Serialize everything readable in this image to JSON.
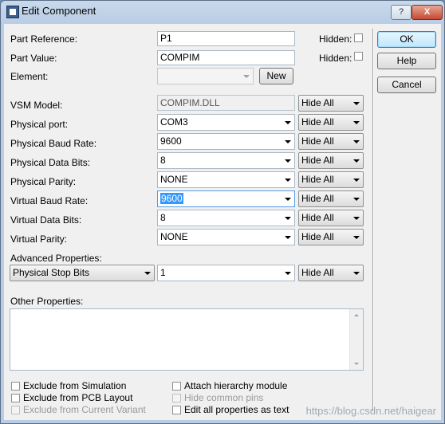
{
  "window": {
    "title": "Edit Component",
    "help_label": "?",
    "close_label": "X"
  },
  "fields": {
    "part_reference": {
      "label": "Part Reference:",
      "value": "P1",
      "hidden_label": "Hidden:"
    },
    "part_value": {
      "label": "Part Value:",
      "value": "COMPIM",
      "hidden_label": "Hidden:"
    },
    "element": {
      "label": "Element:",
      "value": "",
      "new_label": "New"
    }
  },
  "properties": [
    {
      "label": "VSM Model:",
      "value": "COMPIM.DLL",
      "visibility": "Hide All"
    },
    {
      "label": "Physical port:",
      "value": "COM3",
      "visibility": "Hide All"
    },
    {
      "label": "Physical Baud Rate:",
      "value": "9600",
      "visibility": "Hide All"
    },
    {
      "label": "Physical Data Bits:",
      "value": "8",
      "visibility": "Hide All"
    },
    {
      "label": "Physical Parity:",
      "value": "NONE",
      "visibility": "Hide All"
    },
    {
      "label": "Virtual Baud Rate:",
      "value": "9600",
      "visibility": "Hide All"
    },
    {
      "label": "Virtual Data Bits:",
      "value": "8",
      "visibility": "Hide All"
    },
    {
      "label": "Virtual Parity:",
      "value": "NONE",
      "visibility": "Hide All"
    }
  ],
  "advanced": {
    "label": "Advanced Properties:",
    "property": "Physical Stop Bits",
    "value": "1",
    "visibility": "Hide All"
  },
  "other": {
    "label": "Other Properties:"
  },
  "checkboxes": {
    "exclude_simulation": "Exclude from Simulation",
    "exclude_pcb": "Exclude from PCB Layout",
    "exclude_variant": "Exclude from Current Variant",
    "attach_hierarchy": "Attach hierarchy module",
    "hide_common_pins": "Hide common pins",
    "edit_as_text": "Edit all properties as text"
  },
  "buttons": {
    "ok": "OK",
    "help": "Help",
    "cancel": "Cancel"
  },
  "watermark": "https://blog.csdn.net/haigear"
}
